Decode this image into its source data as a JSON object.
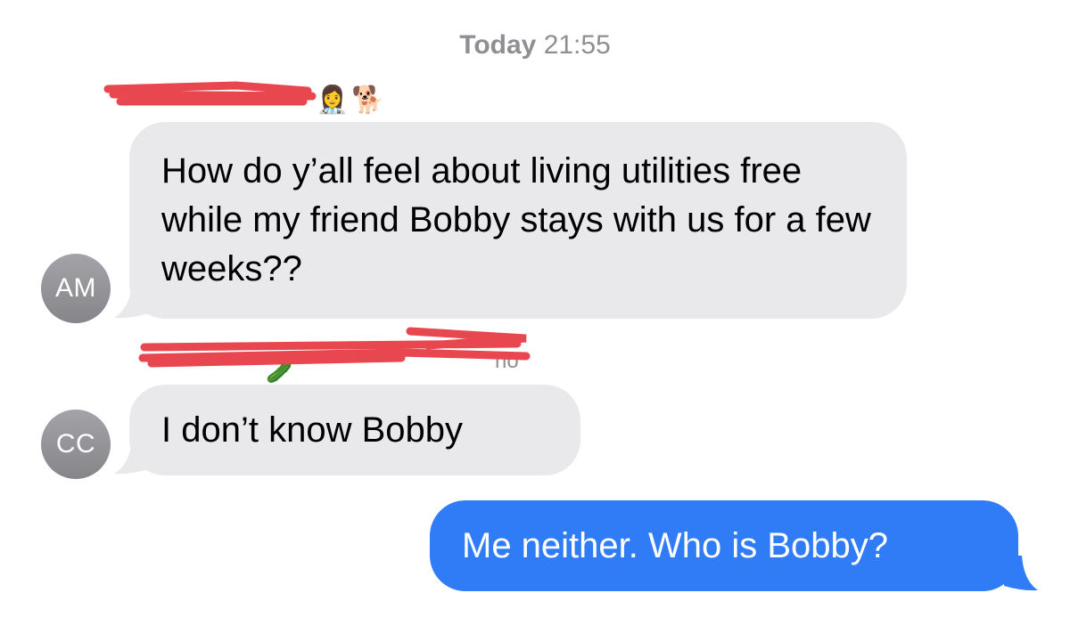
{
  "header": {
    "day": "Today",
    "time": "21:55"
  },
  "messages": [
    {
      "sender_initials": "AM",
      "sender_emoji": [
        "👩‍⚕️",
        "🐕"
      ],
      "text": "How do y’all feel about living utilities free while my friend Bobby stays with us for a few weeks??"
    },
    {
      "sender_initials": "CC",
      "sender_emoji": [
        "🥒"
      ],
      "text": "I don’t know Bobby"
    },
    {
      "sender_initials": "",
      "text": "Me neither. Who is Bobby?"
    }
  ],
  "colors": {
    "incoming_bubble": "#e9e9eb",
    "outgoing_bubble": "#2f7cf6",
    "redaction": "#e8474f",
    "secondary_text": "#8e8e93"
  }
}
